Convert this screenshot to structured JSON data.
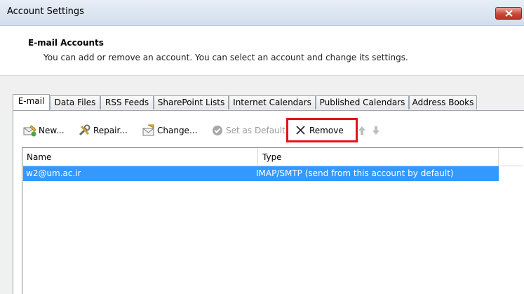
{
  "window": {
    "title": "Account Settings"
  },
  "header": {
    "title": "E-mail Accounts",
    "description": "You can add or remove an account. You can select an account and change its settings."
  },
  "tabs": [
    {
      "label": "E-mail",
      "active": true
    },
    {
      "label": "Data Files"
    },
    {
      "label": "RSS Feeds"
    },
    {
      "label": "SharePoint Lists"
    },
    {
      "label": "Internet Calendars"
    },
    {
      "label": "Published Calendars"
    },
    {
      "label": "Address Books"
    }
  ],
  "toolbar": {
    "new": "New...",
    "repair": "Repair...",
    "change": "Change...",
    "set_default": "Set as Default",
    "remove": "Remove"
  },
  "list": {
    "columns": [
      "Name",
      "Type"
    ],
    "rows": [
      {
        "name": "w2@um.ac.ir",
        "type": "IMAP/SMTP (send from this account by default)"
      }
    ]
  },
  "colors": {
    "selection": "#3399ff",
    "highlight_box": "#e0141c"
  }
}
